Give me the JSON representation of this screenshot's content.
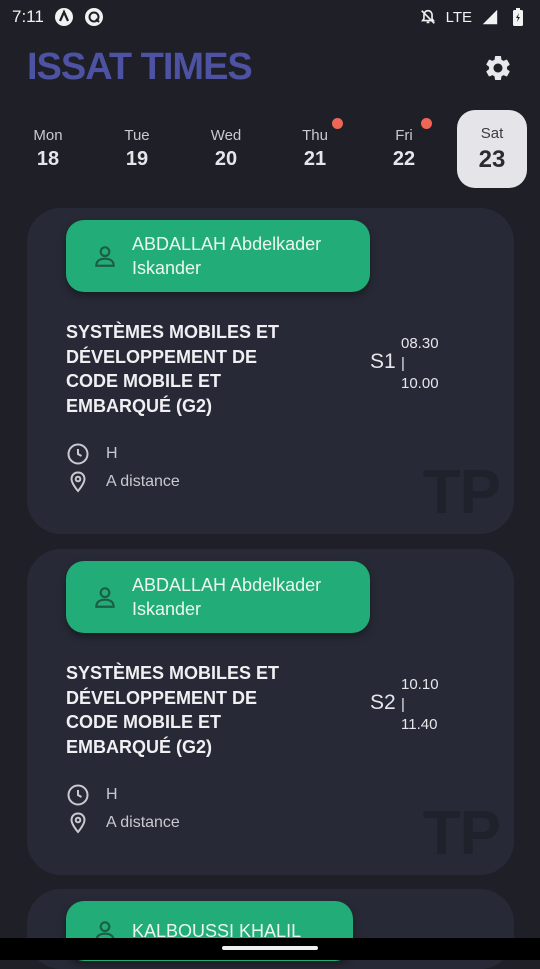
{
  "status_bar": {
    "time": "7:11",
    "network": "LTE"
  },
  "app": {
    "title": "ISSAT TIMES"
  },
  "days": [
    {
      "name": "Mon",
      "num": "18",
      "has_dot": false,
      "selected": false
    },
    {
      "name": "Tue",
      "num": "19",
      "has_dot": false,
      "selected": false
    },
    {
      "name": "Wed",
      "num": "20",
      "has_dot": false,
      "selected": false
    },
    {
      "name": "Thu",
      "num": "21",
      "has_dot": true,
      "selected": false
    },
    {
      "name": "Fri",
      "num": "22",
      "has_dot": true,
      "selected": false
    },
    {
      "name": "Sat",
      "num": "23",
      "has_dot": false,
      "selected": true
    }
  ],
  "sessions": [
    {
      "teacher": "ABDALLAH Abdelkader Iskander",
      "course": "SYSTÈMES MOBILES ET DÉVELOPPEMENT DE CODE MOBILE ET EMBARQUÉ (G2)",
      "session": "S1",
      "start": "08.30",
      "separator": "|",
      "end": "10.00",
      "frequency": "H",
      "location": "A distance",
      "type": "TP"
    },
    {
      "teacher": "ABDALLAH Abdelkader Iskander",
      "course": "SYSTÈMES MOBILES ET DÉVELOPPEMENT DE CODE MOBILE ET EMBARQUÉ (G2)",
      "session": "S2",
      "start": "10.10",
      "separator": "|",
      "end": "11.40",
      "frequency": "H",
      "location": "A distance",
      "type": "TP"
    },
    {
      "teacher": "KALBOUSSI KHALIL"
    }
  ],
  "colors": {
    "accent": "#22ad78",
    "title": "#4e52a3",
    "dot": "#f06656",
    "background": "#1e1f27",
    "card": "#272a36"
  }
}
